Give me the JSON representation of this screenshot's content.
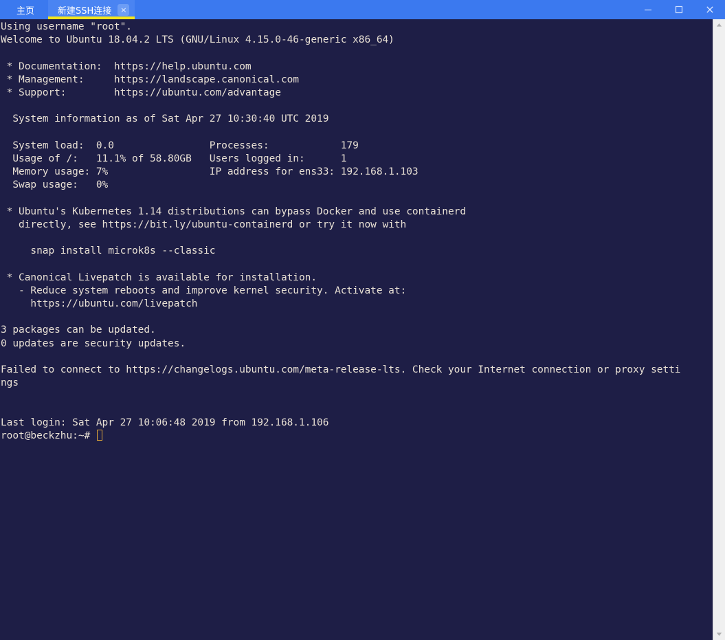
{
  "window": {
    "titlebar_color": "#3b79ef",
    "active_tab_color": "#4a84f2",
    "active_tab_underline_color": "#f5e61a",
    "tabs": [
      {
        "label": "主页",
        "active": false,
        "closable": false
      },
      {
        "label": "新建SSH连接",
        "active": true,
        "closable": true,
        "close_label": "×"
      }
    ],
    "controls": {
      "minimize": "minimize-icon",
      "maximize": "maximize-icon",
      "close": "close-icon"
    }
  },
  "terminal": {
    "background_color": "#1e1e46",
    "foreground_color": "#e8e0d4",
    "cursor_color": "#e0a73a",
    "columns": 123,
    "lines": [
      "Using username \"root\".",
      "Welcome to Ubuntu 18.04.2 LTS (GNU/Linux 4.15.0-46-generic x86_64)",
      "",
      " * Documentation:  https://help.ubuntu.com",
      " * Management:     https://landscape.canonical.com",
      " * Support:        https://ubuntu.com/advantage",
      "",
      "  System information as of Sat Apr 27 10:30:40 UTC 2019",
      "",
      "  System load:  0.0                Processes:            179",
      "  Usage of /:   11.1% of 58.80GB   Users logged in:      1",
      "  Memory usage: 7%                 IP address for ens33: 192.168.1.103",
      "  Swap usage:   0%",
      "",
      " * Ubuntu's Kubernetes 1.14 distributions can bypass Docker and use containerd",
      "   directly, see https://bit.ly/ubuntu-containerd or try it now with",
      "",
      "     snap install microk8s --classic",
      "",
      " * Canonical Livepatch is available for installation.",
      "   - Reduce system reboots and improve kernel security. Activate at:",
      "     https://ubuntu.com/livepatch",
      "",
      "3 packages can be updated.",
      "0 updates are security updates.",
      "",
      "Failed to connect to https://changelogs.ubuntu.com/meta-release-lts. Check your Internet connection or proxy setti",
      "ngs",
      "",
      "",
      "Last login: Sat Apr 27 10:06:48 2019 from 192.168.1.106"
    ],
    "prompt": "root@beckzhu:~# ",
    "input_value": ""
  },
  "scrollbar": {
    "track_color": "#f0f0f0",
    "up_arrow": "scroll-up-icon",
    "down_arrow": "scroll-down-icon"
  }
}
